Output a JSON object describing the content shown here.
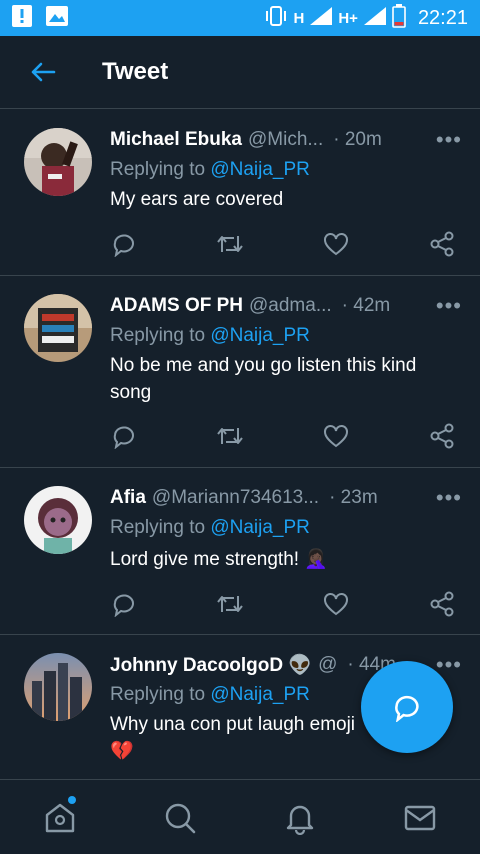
{
  "status_bar": {
    "network_1": "H",
    "network_2": "H+",
    "time": "22:21",
    "icons": [
      "alert-icon",
      "image-icon",
      "vibrate-icon",
      "signal-icon",
      "battery-icon"
    ]
  },
  "header": {
    "back_icon": "arrow-left-icon",
    "title": "Tweet"
  },
  "tweets": [
    {
      "name": "Michael Ebuka",
      "handle": "@Mich...",
      "time": "· 20m",
      "reply_prefix": "Replying to",
      "reply_to": "@Naija_PR",
      "text": "My ears are covered"
    },
    {
      "name": "ADAMS OF PH",
      "handle": "@adma...",
      "time": "· 42m",
      "reply_prefix": "Replying to",
      "reply_to": "@Naija_PR",
      "text": "No be me and you go listen this kind song"
    },
    {
      "name": "Afia",
      "handle": "@Mariann734613...",
      "time": "· 23m",
      "reply_prefix": "Replying to",
      "reply_to": "@Naija_PR",
      "text": "Lord give me strength! 🤦🏿‍♀️"
    },
    {
      "name": "Johnny DacoolgoD 👽",
      "handle": "@",
      "time": "· 44m",
      "reply_prefix": "Replying to",
      "reply_to": "@Naija_PR",
      "text": "Why una con put laugh emoji 💔"
    }
  ],
  "more_symbol": "•••",
  "colors": {
    "background": "#15202b",
    "accent": "#1da1f2",
    "muted": "#8899a6",
    "divider": "#38444d"
  },
  "bottom_nav": [
    "home-icon",
    "search-icon",
    "notifications-icon",
    "messages-icon"
  ]
}
